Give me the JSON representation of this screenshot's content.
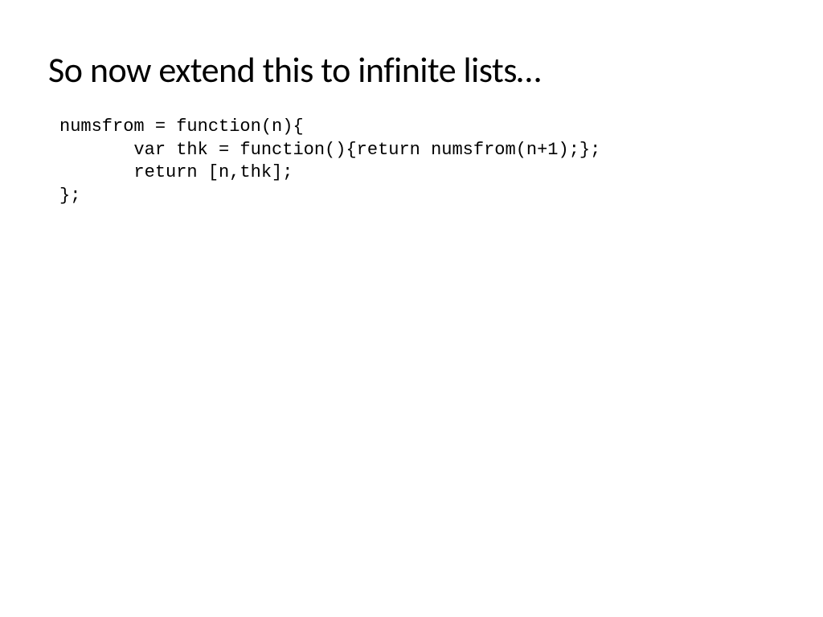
{
  "slide": {
    "title": "So now extend this to infinite lists…",
    "code": "numsfrom = function(n){\n       var thk = function(){return numsfrom(n+1);};\n       return [n,thk];\n};"
  }
}
